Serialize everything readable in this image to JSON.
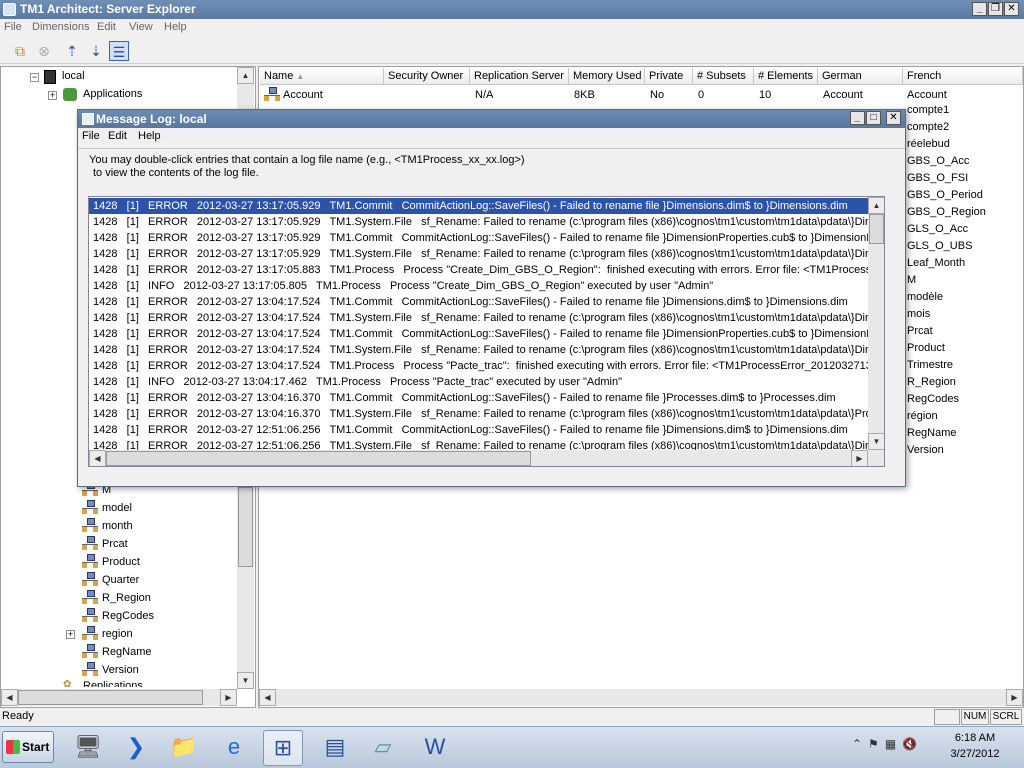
{
  "app": {
    "title": "TM1 Architect: Server Explorer",
    "menu": [
      "File",
      "Dimensions",
      "Edit",
      "View",
      "Help"
    ],
    "toolbar_icons": [
      "copy-icon",
      "cancel-icon",
      "sort-ascending-icon",
      "sort-descending-icon",
      "properties-view-icon"
    ]
  },
  "tree": {
    "top": [
      {
        "label": "local",
        "icon": "server-icon"
      },
      {
        "label": "Applications",
        "icon": "applications-icon"
      }
    ],
    "dims": [
      "M",
      "model",
      "month",
      "Prcat",
      "Product",
      "Quarter",
      "R_Region",
      "RegCodes",
      "region",
      "RegName",
      "Version"
    ],
    "bottom": "Replications"
  },
  "list": {
    "columns": [
      "Name",
      "Security Owner",
      "Replication Server",
      "Memory Used",
      "Private",
      "# Subsets",
      "# Elements",
      "German",
      "French"
    ],
    "row": {
      "name": "Account",
      "security_owner": "",
      "replication_server": "N/A",
      "memory_used": "8KB",
      "private": "No",
      "subsets": "0",
      "elements": "10",
      "german": "Account",
      "french": "Account"
    },
    "french_more": [
      "compte1",
      "compte2",
      "réelebud",
      "GBS_O_Acc",
      "GBS_O_FSI",
      "GBS_O_Period",
      "GBS_O_Region",
      "GLS_O_Acc",
      "GLS_O_UBS",
      "Leaf_Month",
      "M",
      "modèle",
      "mois",
      "Prcat",
      "Product",
      "Trimestre",
      "R_Region",
      "RegCodes",
      "région",
      "RegName",
      "Version"
    ]
  },
  "dialog": {
    "title": "Message Log: local",
    "menu": [
      "File",
      "Edit",
      "Help"
    ],
    "info_line1": "You may double-click entries that contain a log file name (e.g., <TM1Process_xx_xx.log>)",
    "info_line2": "to view the contents of the log file.",
    "log": [
      "1428   [1]   ERROR   2012-03-27 13:17:05.929   TM1.Commit   CommitActionLog::SaveFiles() - Failed to rename file }Dimensions.dim$ to }Dimensions.dim",
      "1428   [1]   ERROR   2012-03-27 13:17:05.929   TM1.System.File   sf_Rename: Failed to rename (c:\\program files (x86)\\cognos\\tm1\\custom\\tm1data\\pdata\\}Dim",
      "1428   [1]   ERROR   2012-03-27 13:17:05.929   TM1.Commit   CommitActionLog::SaveFiles() - Failed to rename file }DimensionProperties.cub$ to }DimensionProp",
      "1428   [1]   ERROR   2012-03-27 13:17:05.929   TM1.System.File   sf_Rename: Failed to rename (c:\\program files (x86)\\cognos\\tm1\\custom\\tm1data\\pdata\\}Dim",
      "1428   [1]   ERROR   2012-03-27 13:17:05.883   TM1.Process   Process \"Create_Dim_GBS_O_Region\":  finished executing with errors. Error file: <TM1ProcessErro",
      "1428   [1]   INFO   2012-03-27 13:17:05.805   TM1.Process   Process \"Create_Dim_GBS_O_Region\" executed by user \"Admin\"",
      "1428   [1]   ERROR   2012-03-27 13:04:17.524   TM1.Commit   CommitActionLog::SaveFiles() - Failed to rename file }Dimensions.dim$ to }Dimensions.dim",
      "1428   [1]   ERROR   2012-03-27 13:04:17.524   TM1.System.File   sf_Rename: Failed to rename (c:\\program files (x86)\\cognos\\tm1\\custom\\tm1data\\pdata\\}Dim",
      "1428   [1]   ERROR   2012-03-27 13:04:17.524   TM1.Commit   CommitActionLog::SaveFiles() - Failed to rename file }DimensionProperties.cub$ to }DimensionProp",
      "1428   [1]   ERROR   2012-03-27 13:04:17.524   TM1.System.File   sf_Rename: Failed to rename (c:\\program files (x86)\\cognos\\tm1\\custom\\tm1data\\pdata\\}Dim",
      "1428   [1]   ERROR   2012-03-27 13:04:17.524   TM1.Process   Process \"Pacte_trac\":  finished executing with errors. Error file: <TM1ProcessError_20120327130",
      "1428   [1]   INFO   2012-03-27 13:04:17.462   TM1.Process   Process \"Pacte_trac\" executed by user \"Admin\"",
      "1428   [1]   ERROR   2012-03-27 13:04:16.370   TM1.Commit   CommitActionLog::SaveFiles() - Failed to rename file }Processes.dim$ to }Processes.dim",
      "1428   [1]   ERROR   2012-03-27 13:04:16.370   TM1.System.File   sf_Rename: Failed to rename (c:\\program files (x86)\\cognos\\tm1\\custom\\tm1data\\pdata\\}Pro",
      "1428   [1]   ERROR   2012-03-27 12:51:06.256   TM1.Commit   CommitActionLog::SaveFiles() - Failed to rename file }Dimensions.dim$ to }Dimensions.dim",
      "1428   [1]   ERROR   2012-03-27 12:51:06.256   TM1.System.File   sf_Rename: Failed to rename (c:\\program files (x86)\\cognos\\tm1\\custom\\tm1data\\pdata\\}Dim"
    ]
  },
  "status": {
    "text": "Ready",
    "num": "NUM",
    "scrl": "SCRL"
  },
  "taskbar": {
    "start": "Start",
    "time": "6:18 AM",
    "date": "3/27/2012",
    "apps": [
      "server-manager-icon",
      "powershell-icon",
      "explorer-icon",
      "internet-explorer-icon",
      "tm1-architect-icon",
      "message-log-icon",
      "notepad-icon",
      "word-icon"
    ]
  },
  "colors": {
    "title_bar": "#5a7aa3",
    "selection": "#2b54a8"
  }
}
